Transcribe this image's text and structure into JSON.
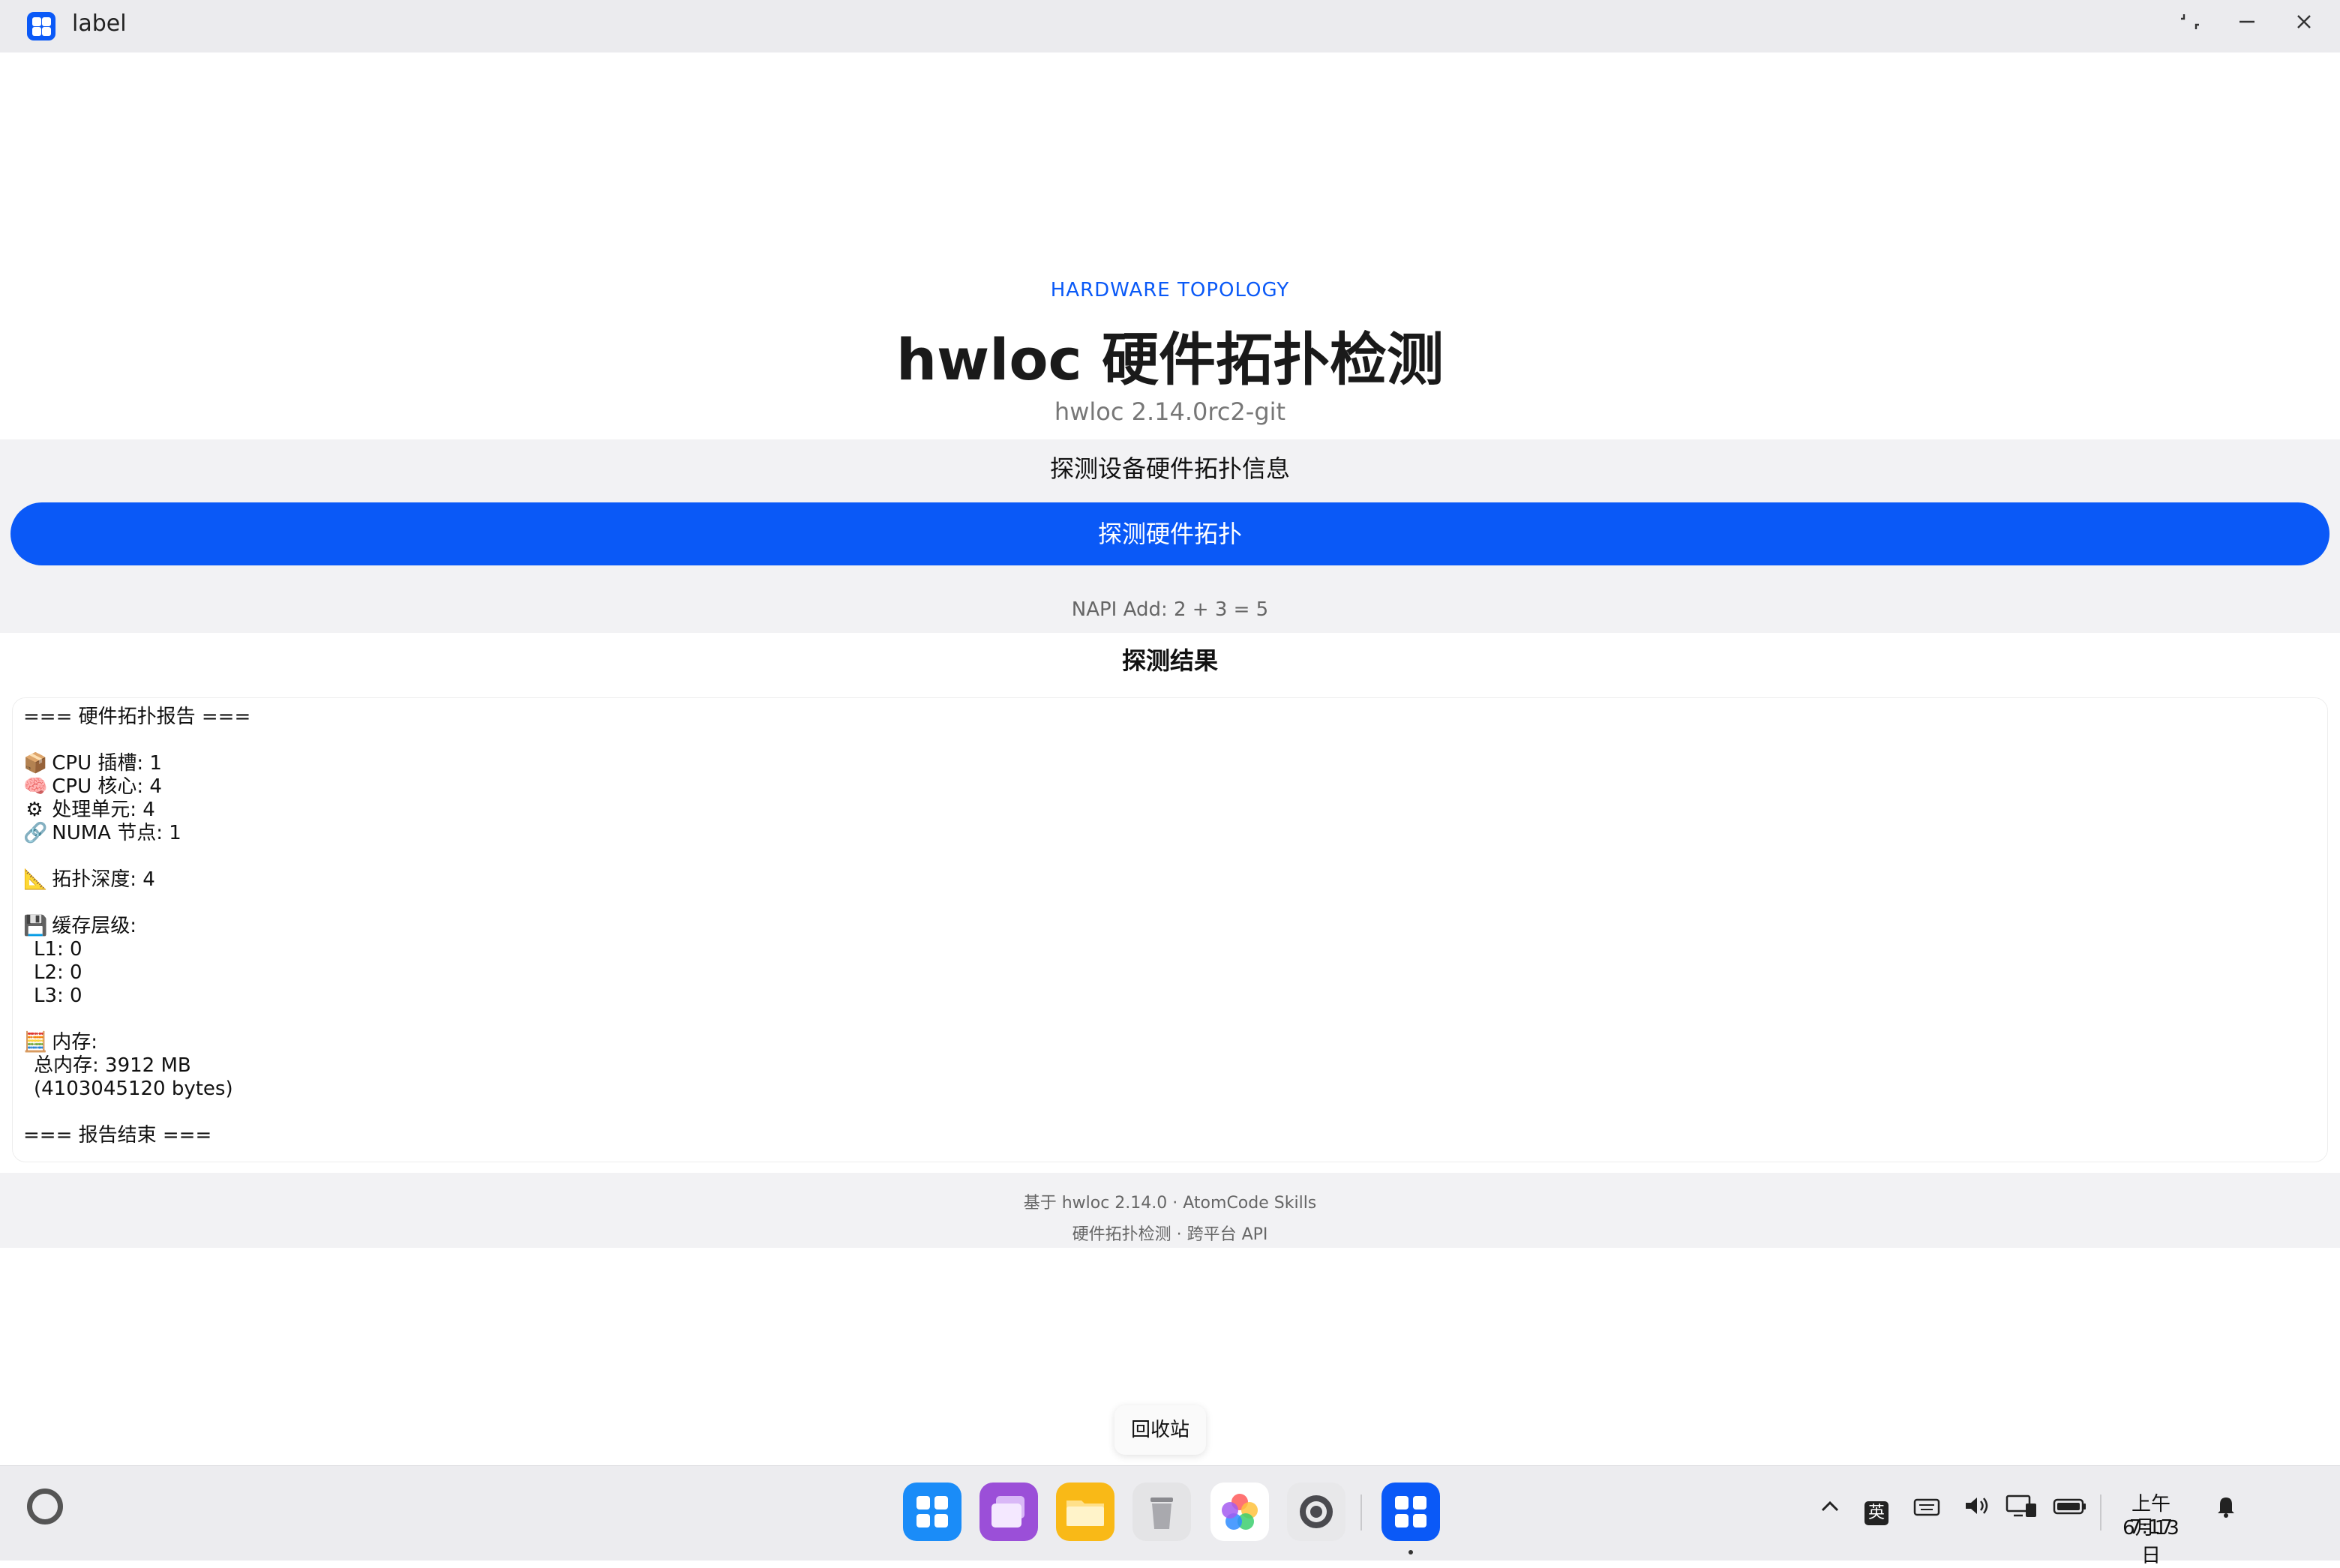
{
  "window": {
    "title": "label"
  },
  "header": {
    "eyebrow": "HARDWARE TOPOLOGY",
    "title": "hwloc 硬件拓扑检测",
    "version": "hwloc 2.14.0rc2-git"
  },
  "probe": {
    "heading": "探测设备硬件拓扑信息",
    "button_label": "探测硬件拓扑",
    "napi_text": "NAPI Add: 2 + 3 = 5"
  },
  "result": {
    "heading": "探测结果",
    "report": {
      "start": "=== 硬件拓扑报告 ===",
      "cpu_sockets": "CPU 插槽: 1",
      "cpu_cores": "CPU 核心: 4",
      "processing_units": "处理单元: 4",
      "numa_nodes": "NUMA 节点: 1",
      "topology_depth": "拓扑深度: 4",
      "cache_levels": "缓存层级:",
      "l1": "L1: 0",
      "l2": "L2: 0",
      "l3": "L3: 0",
      "memory": "内存:",
      "total_memory": "总内存: 3912 MB",
      "total_bytes": "(4103045120 bytes)",
      "end": "=== 报告结束 ==="
    }
  },
  "footer": {
    "line1": "基于 hwloc 2.14.0 · AtomCode Skills",
    "line2": "硬件拓扑检测 · 跨平台 API"
  },
  "tooltip": "回收站",
  "tray": {
    "ime": "英",
    "time": "上午7:17",
    "date": "6月13日"
  },
  "colors": {
    "accent": "#0a59f7",
    "section_bg": "#f2f2f4",
    "titlebar_bg": "#ebebee"
  },
  "icons": {
    "report": [
      "package-icon",
      "brain-icon",
      "gear-icon",
      "link-icon",
      "ruler-icon",
      "floppy-disk-icon",
      "abacus-icon"
    ],
    "dock": [
      "app-center-icon",
      "multitask-icon",
      "files-icon",
      "trash-icon",
      "gallery-icon",
      "settings-icon",
      "label-app-icon"
    ],
    "tray": [
      "chevron-up-icon",
      "keyboard-icon",
      "volume-icon",
      "device-icon",
      "battery-icon",
      "bell-icon"
    ]
  }
}
